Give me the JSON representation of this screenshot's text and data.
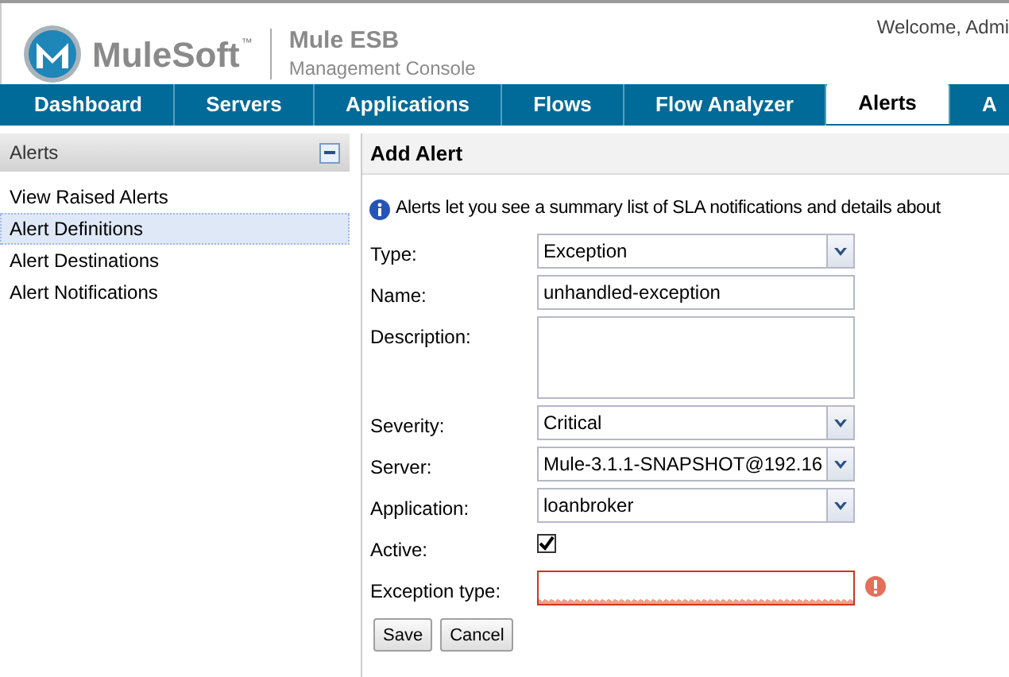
{
  "header": {
    "brand": "MuleSoft",
    "trademark": "™",
    "product": "Mule ESB",
    "subtitle": "Management Console",
    "welcome": "Welcome, Admi"
  },
  "tabs": [
    {
      "label": "Dashboard",
      "selected": false
    },
    {
      "label": "Servers",
      "selected": false
    },
    {
      "label": "Applications",
      "selected": false
    },
    {
      "label": "Flows",
      "selected": false
    },
    {
      "label": "Flow Analyzer",
      "selected": false
    },
    {
      "label": "Alerts",
      "selected": true
    },
    {
      "label": "A",
      "selected": false
    }
  ],
  "sidebar": {
    "title": "Alerts",
    "items": [
      {
        "label": "View Raised Alerts",
        "selected": false
      },
      {
        "label": "Alert Definitions",
        "selected": true
      },
      {
        "label": "Alert Destinations",
        "selected": false
      },
      {
        "label": "Alert Notifications",
        "selected": false
      }
    ]
  },
  "form": {
    "title": "Add Alert",
    "info": "Alerts let you see a summary list of SLA notifications and details about",
    "fields": [
      {
        "kind": "select",
        "label": "Type:",
        "value": "Exception"
      },
      {
        "kind": "text",
        "label": "Name:",
        "value": "unhandled-exception"
      },
      {
        "kind": "textarea",
        "label": "Description:"
      },
      {
        "kind": "select",
        "label": "Severity:",
        "value": "Critical"
      },
      {
        "kind": "select",
        "label": "Server:",
        "value": "Mule-3.1.1-SNAPSHOT@192.16"
      },
      {
        "kind": "select",
        "label": "Application:",
        "value": "loanbroker"
      },
      {
        "kind": "checkbox",
        "label": "Active:",
        "checked": true
      },
      {
        "kind": "text",
        "label": "Exception type:",
        "invalid": true
      }
    ],
    "buttons": [
      "Save",
      "Cancel"
    ]
  }
}
